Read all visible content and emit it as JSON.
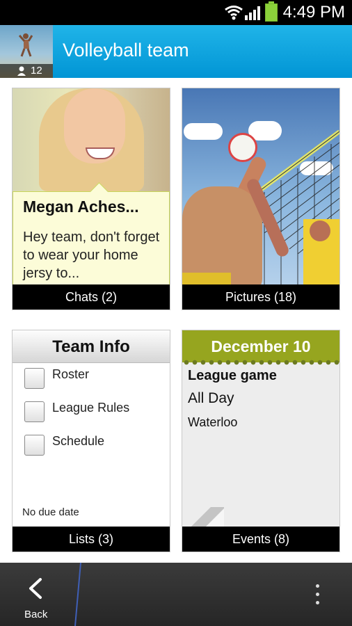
{
  "status_bar": {
    "time": "4:49 PM",
    "icons": [
      "wifi-icon",
      "signal-icon",
      "battery-icon"
    ]
  },
  "header": {
    "title": "Volleyball team",
    "member_count": "12",
    "avatar_icon": "group-avatar-icon"
  },
  "tiles": {
    "chats": {
      "sender": "Megan Aches...",
      "message": "Hey team, don't forget to wear your home jersy to...",
      "footer": "Chats (2)"
    },
    "pictures": {
      "footer": "Pictures (18)"
    },
    "lists": {
      "title": "Team Info",
      "items": [
        "Roster",
        "League Rules",
        "Schedule"
      ],
      "due_text": "No due date",
      "footer": "Lists (3)"
    },
    "events": {
      "date": "December 10",
      "title": "League game",
      "time": "All Day",
      "location": "Waterloo",
      "footer": "Events (8)"
    }
  },
  "bottom_nav": {
    "back_label": "Back",
    "back_icon": "chevron-left-icon",
    "menu_icon": "overflow-menu-icon"
  },
  "colors": {
    "header_blue": "#0195d5",
    "chat_bubble": "#fcfcd8",
    "event_green": "#96a51f"
  }
}
